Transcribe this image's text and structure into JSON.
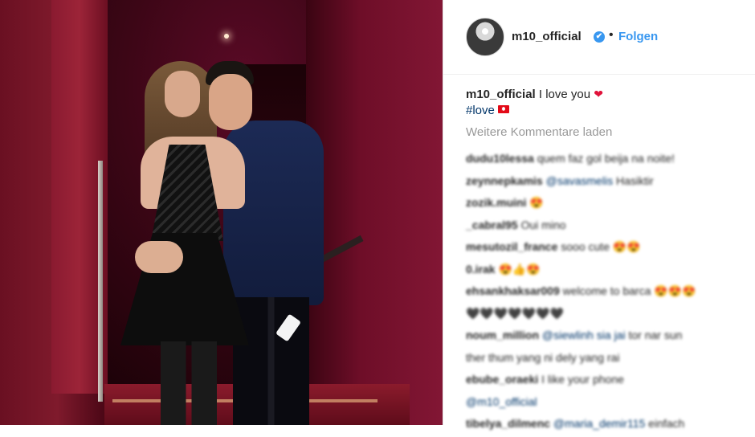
{
  "post": {
    "username": "m10_official",
    "follow_label": "Folgen",
    "separator": "•",
    "verified_glyph": "✔",
    "caption_text": "I love you",
    "caption_emoji": "❤",
    "hashtag": "#love",
    "load_more_label": "Weitere Kommentare laden"
  },
  "icons": {
    "verified": "verified-badge-icon",
    "heart": "heart-icon",
    "flag": "turkey-flag-icon"
  },
  "colors": {
    "accent": "#3897f0",
    "text": "#262626",
    "muted": "#999999",
    "link": "#003569",
    "heart": "#e0123a"
  },
  "comments": [
    {
      "user": "dudu10lessa",
      "text": "quem faz gol beija na noite!",
      "mention": "",
      "emoji": ""
    },
    {
      "user": "zeynnepkamis",
      "text": "Hasiktir",
      "mention": "@savasmelis",
      "emoji": ""
    },
    {
      "user": "zozik.muini",
      "text": "",
      "mention": "",
      "emoji": "😍"
    },
    {
      "user": "_cabral95",
      "text": "Oui mino",
      "mention": "",
      "emoji": ""
    },
    {
      "user": "mesutozil_france",
      "text": "sooo cute",
      "mention": "",
      "emoji": "😍😍"
    },
    {
      "user": "0.irak",
      "text": "",
      "mention": "",
      "emoji": "😍👍😍"
    },
    {
      "user": "ehsankhaksar009",
      "text": "welcome to barca",
      "mention": "",
      "emoji": "😍😍😍"
    },
    {
      "user": "",
      "text": "",
      "mention": "",
      "emoji": "🖤🖤🖤🖤🖤🖤🖤"
    },
    {
      "user": "noum_million",
      "text": "tor nar sun",
      "mention": "@siewlinh sia jai",
      "emoji": ""
    },
    {
      "user": "",
      "text": "ther thum yang ni dely yang rai",
      "mention": "",
      "emoji": ""
    },
    {
      "user": "ebube_oraeki",
      "text": "I like your phone",
      "mention": "",
      "emoji": ""
    },
    {
      "user": "",
      "text": "",
      "mention": "@m10_official",
      "emoji": ""
    },
    {
      "user": "tibelya_dilmenc",
      "text": "einfach",
      "mention": "@maria_demir115",
      "emoji": ""
    }
  ]
}
